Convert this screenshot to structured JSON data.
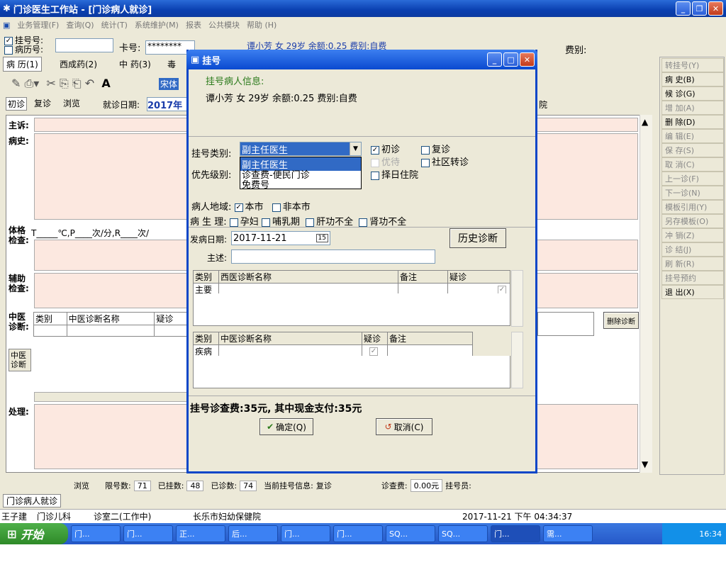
{
  "window": {
    "title": "门诊医生工作站 - [门诊病人就诊]"
  },
  "menu": [
    "业务管理(F)",
    "查询(Q)",
    "统计(T)",
    "系统维护(M)",
    "报表",
    "公共模块",
    "帮助 (H)"
  ],
  "reg_row": {
    "reg_no_label": "挂号号:",
    "record_no_label": "病历号:",
    "card_label": "卡号:",
    "card_value": "********",
    "patient_info": "谭小芳 女 29岁 余额:0.25 费别:自费",
    "fee_label": "费别:"
  },
  "tabs": [
    "病 历(1)",
    "西成药(2)",
    "中 药(3)",
    "毒"
  ],
  "font_name": "宋体",
  "visit_tabs": [
    "初诊",
    "复诊",
    "浏览"
  ],
  "visit_date_label": "就诊日期:",
  "visit_date": "2017年",
  "hosp_fragment": "院",
  "sections": {
    "chief": "主诉:",
    "history": "病史:",
    "exam": "体格检查:",
    "exam_text": "T_____℃,P____次/分,R____次/",
    "aux": "辅助检查:",
    "tcm_diag": "中医诊断:",
    "tcm_diag2": "中医诊断",
    "treatment": "处理:"
  },
  "tcm_grid_headers": [
    "类别",
    "中医诊断名称",
    "疑诊"
  ],
  "delete_diag": "删除诊断",
  "side_buttons": [
    "转挂号(Y)",
    "病 史(B)",
    "候 诊(G)",
    "增 加(A)",
    "删 除(D)",
    "编 辑(E)",
    "保 存(S)",
    "取 消(C)",
    "上一诊(F)",
    "下一诊(N)",
    "模板引用(Y)",
    "另存模板(O)",
    "冲 销(Z)",
    "诊 结(J)",
    "刷 新(R)",
    "挂号预约",
    "退 出(X)"
  ],
  "dialog": {
    "title": "挂号",
    "info_header": "挂号病人信息:",
    "info_text": "谭小芳 女 29岁 余额:0.25 费别:自费",
    "reg_type_label": "挂号类别:",
    "reg_type_value": "副主任医生",
    "dropdown_options": [
      "副主任医生",
      "诊查费-便民门诊",
      "免费号"
    ],
    "priority_label": "优先级别:",
    "chk_first": "初诊",
    "chk_return": "复诊",
    "chk_priority": "优待",
    "chk_community": "社区转诊",
    "chk_admit": "择日住院",
    "region_label": "病人地域:",
    "region_local": "本市",
    "region_nonlocal": "非本市",
    "physio_label": "病 生 理:",
    "physio": [
      "孕妇",
      "哺乳期",
      "肝功不全",
      "肾功不全"
    ],
    "onset_label": "发病日期:",
    "onset_date": "2017-11-21",
    "history_button": "历史诊断",
    "chief_label": "主述:",
    "west_headers": [
      "类别",
      "西医诊断名称",
      "备注",
      "疑诊"
    ],
    "west_row": "主要",
    "tcm_headers": [
      "类别",
      "中医诊断名称",
      "疑诊",
      "备注"
    ],
    "tcm_row": "疾病",
    "fee_text": "挂号诊查费:35元, 其中现金支付:35元",
    "ok": "确定(Q)",
    "cancel": "取消(C)"
  },
  "status": {
    "browse": "浏览",
    "limit_label": "限号数:",
    "limit": "71",
    "registered_label": "已挂数:",
    "registered": "48",
    "seen_label": "已诊数:",
    "seen": "74",
    "current_label": "当前挂号信息:",
    "current": "复诊",
    "fee_label": "诊查费:",
    "fee": "0.00元",
    "staff_label": "挂号员:"
  },
  "bottom_tab": "门诊病人就诊",
  "footer": {
    "doctor": "王子建",
    "dept": "门诊儿科",
    "room": "诊室二(工作中)",
    "hospital": "长乐市妇幼保健院",
    "datetime": "2017-11-21 下午 04:34:37"
  },
  "taskbar": {
    "start": "开始",
    "tasks": [
      "门...",
      "门...",
      "正...",
      "后...",
      "门...",
      "门...",
      "SQ...",
      "SQ...",
      "门...",
      "需..."
    ],
    "clock": "16:34"
  }
}
